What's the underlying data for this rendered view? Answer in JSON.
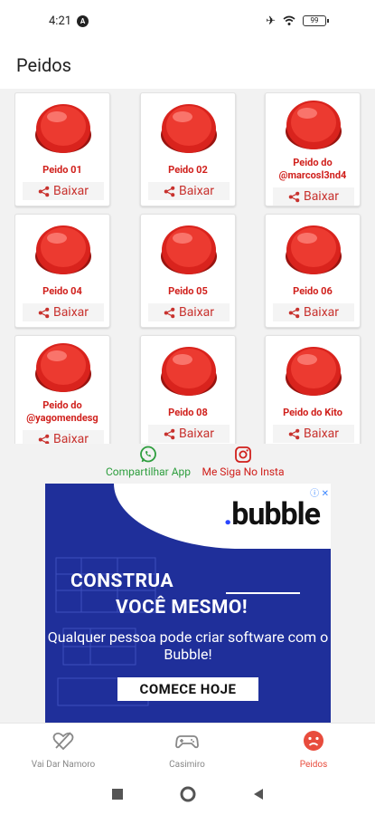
{
  "status_bar": {
    "time": "4:21",
    "battery": "99"
  },
  "app_bar": {
    "title": "Peidos"
  },
  "cards": [
    {
      "label": "Peido 01",
      "download": "Baixar"
    },
    {
      "label": "Peido 02",
      "download": "Baixar"
    },
    {
      "label": "Peido do @marcosl3nd4",
      "download": "Baixar"
    },
    {
      "label": "Peido 04",
      "download": "Baixar"
    },
    {
      "label": "Peido 05",
      "download": "Baixar"
    },
    {
      "label": "Peido 06",
      "download": "Baixar"
    },
    {
      "label": "Peido do @yagomendesg",
      "download": "Baixar"
    },
    {
      "label": "Peido 08",
      "download": "Baixar"
    },
    {
      "label": "Peido do Kito",
      "download": "Baixar"
    }
  ],
  "social": {
    "share_label": "Compartilhar App",
    "insta_label": "Me Siga No Insta",
    "share_color": "#2e9e3e",
    "insta_color": "#d0201c"
  },
  "ad": {
    "logo": "bubble",
    "headline_1": "CONSTRUA",
    "headline_2": "VOCÊ MESMO!",
    "body": "Qualquer pessoa pode criar software com o Bubble!",
    "cta": "COMECE HOJE"
  },
  "bottom_nav": [
    {
      "label": "Vai Dar Namoro",
      "icon": "broken-heart-icon",
      "active": false
    },
    {
      "label": "Casimiro",
      "icon": "gamepad-icon",
      "active": false
    },
    {
      "label": "Peidos",
      "icon": "sad-face-icon",
      "active": true
    }
  ],
  "colors": {
    "accent": "#e84c3d",
    "button_red": "#d0201c",
    "ad_bg": "#1f2f9a"
  }
}
